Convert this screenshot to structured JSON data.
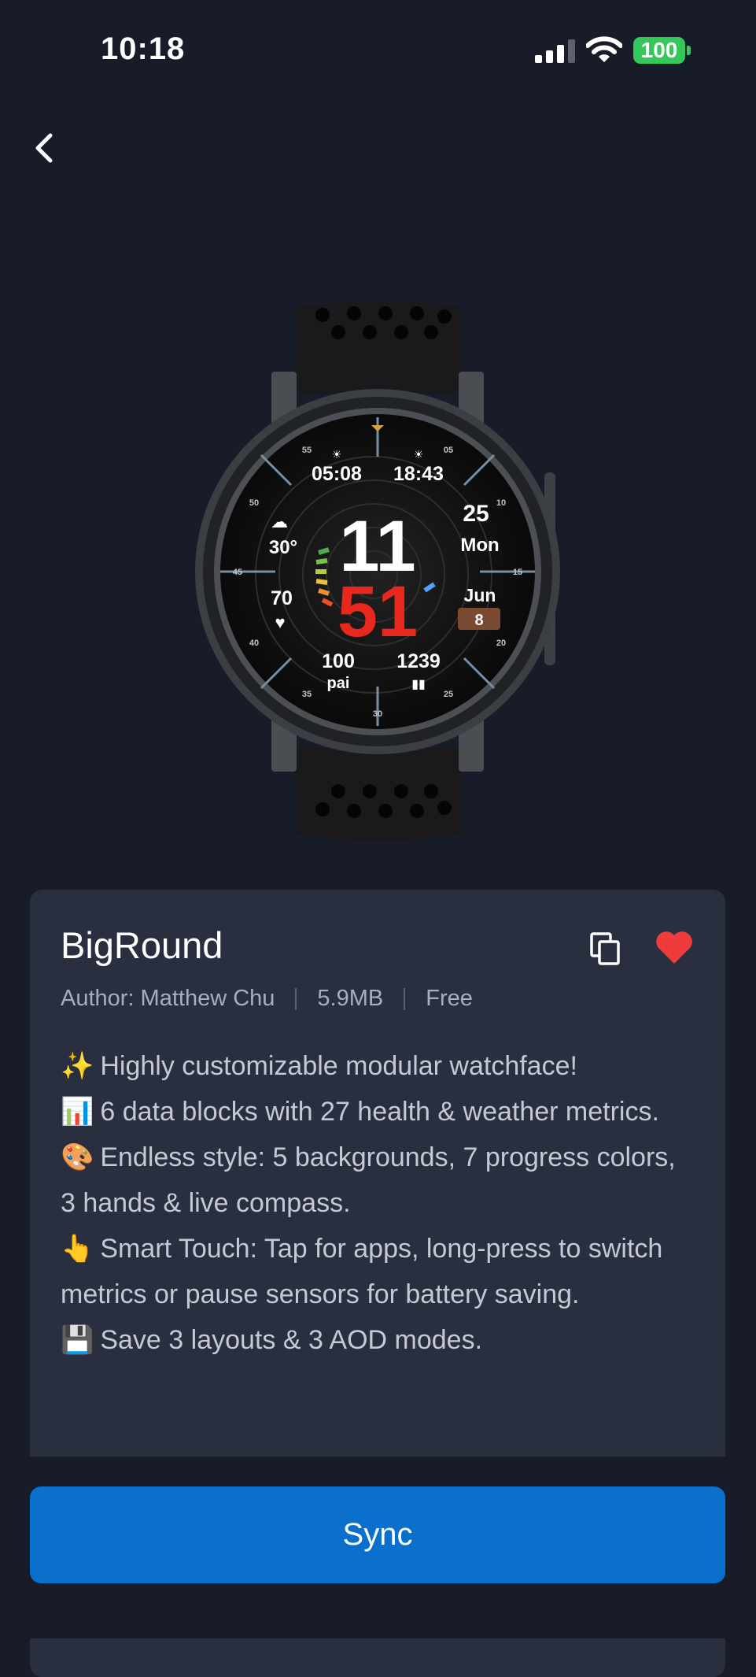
{
  "status_bar": {
    "time": "10:18",
    "battery": "100"
  },
  "watch_preview": {
    "sunrise": "05:08",
    "sunset": "18:43",
    "temperature": "30°",
    "hour": "11",
    "minute": "51",
    "day": "25",
    "weekday": "Mon",
    "heart_rate": "70",
    "month": "Jun",
    "month_number": "8",
    "pai_value": "100",
    "pai_label": "pai",
    "steps": "1239",
    "bezel": {
      "n55": "55",
      "n05": "05",
      "n50": "50",
      "n10": "10",
      "n45": "45",
      "n15": "15",
      "n40": "40",
      "n20": "20",
      "n35": "35",
      "n25": "25",
      "n30": "30"
    }
  },
  "watchface": {
    "title": "BigRound",
    "author": "Author: Matthew Chu",
    "size": "5.9MB",
    "price": "Free",
    "description": [
      {
        "emoji": "✨",
        "text": "Highly customizable modular watchface!"
      },
      {
        "emoji": "📊",
        "text": "6 data blocks with 27 health & weather metrics."
      },
      {
        "emoji": "🎨",
        "text": "Endless style: 5 backgrounds, 7 progress colors, 3 hands & live compass."
      },
      {
        "emoji": "👆",
        "text": "Smart Touch: Tap for apps, long-press to switch metrics or pause sensors for battery saving."
      },
      {
        "emoji": "💾",
        "text": "Save 3 layouts & 3 AOD modes."
      }
    ]
  },
  "actions": {
    "sync_label": "Sync"
  },
  "colors": {
    "accent": "#0b6fcc",
    "background": "#181c29",
    "card": "#2a2f3f",
    "heart": "#ee3b3b",
    "minute_red": "#e8281e"
  }
}
